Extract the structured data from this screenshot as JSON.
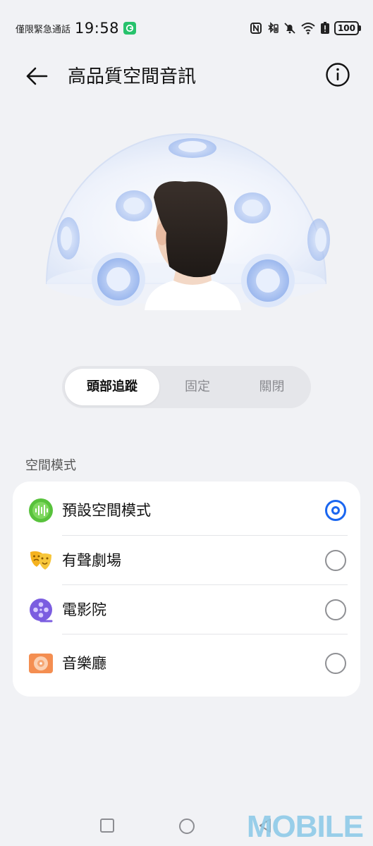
{
  "status_bar": {
    "carrier": "僅限緊急通話",
    "time": "19:58",
    "battery": "100"
  },
  "app_bar": {
    "title": "高品質空間音訊"
  },
  "mode_switch": {
    "options": [
      "頭部追蹤",
      "固定",
      "關閉"
    ],
    "selected": "頭部追蹤"
  },
  "spatial_mode": {
    "section_label": "空間模式",
    "options": [
      {
        "label": "預設空間模式",
        "icon": "soundwave-icon",
        "color": "#58c23c",
        "selected": true
      },
      {
        "label": "有聲劇場",
        "icon": "theater-masks-icon",
        "color": "#f5b21f",
        "selected": false
      },
      {
        "label": "電影院",
        "icon": "film-reel-icon",
        "color": "#7b5de0",
        "selected": false
      },
      {
        "label": "音樂廳",
        "icon": "music-hall-icon",
        "color": "#f07a3a",
        "selected": false
      }
    ]
  },
  "watermark": "MOBILE",
  "colors": {
    "accent": "#1a66f0",
    "background": "#f1f2f5"
  }
}
